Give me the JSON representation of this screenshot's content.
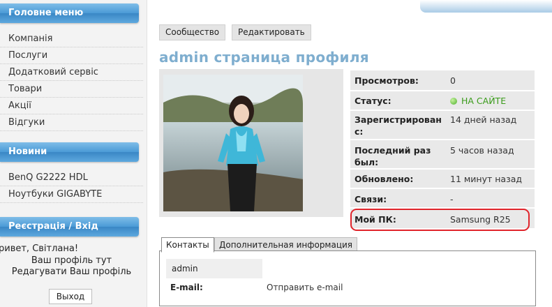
{
  "sidebar": {
    "main_menu": {
      "title": "Головне меню",
      "items": [
        "Компанія",
        "Послуги",
        "Додатковий сервіс",
        "Товари",
        "Акції",
        "Відгуки"
      ]
    },
    "news": {
      "title": "Новини",
      "items": [
        "BenQ G2222 HDL",
        "Ноутбуки GIGABYTE"
      ]
    },
    "login": {
      "title": "Реєстрація / Вхід",
      "greeting": "ривет, Світлана!",
      "profile_link": "Ваш профіль тут",
      "edit_link": "Редагувати Ваш профіль",
      "exit_button": "Выход"
    }
  },
  "toolbar": {
    "community": "Сообщество",
    "edit": "Редактировать"
  },
  "profile": {
    "title": "admin страница профиля",
    "fields": [
      {
        "label": "Просмотров:",
        "value": "0"
      },
      {
        "label": "Статус:",
        "value": "НА САЙТЕ"
      },
      {
        "label": "Зарегистрирован с:",
        "value": "14 дней назад"
      },
      {
        "label": "Последний раз был:",
        "value": "5 часов назад"
      },
      {
        "label": "Обновлено:",
        "value": "11 минут назад"
      },
      {
        "label": "Связи:",
        "value": "-"
      },
      {
        "label": "Мой ПК:",
        "value": "Samsung R25"
      }
    ]
  },
  "lower_tabs": {
    "contacts": "Контакты",
    "additional": "Дополнительная информация",
    "contact_name": "admin",
    "email_label": "E-mail:",
    "email_link": "Отправить e-mail"
  },
  "colors": {
    "accent_blue": "#4a9ad6",
    "title_blue": "#7faecf",
    "online_green": "#3a9b1a",
    "highlight_red": "#e0242b"
  }
}
